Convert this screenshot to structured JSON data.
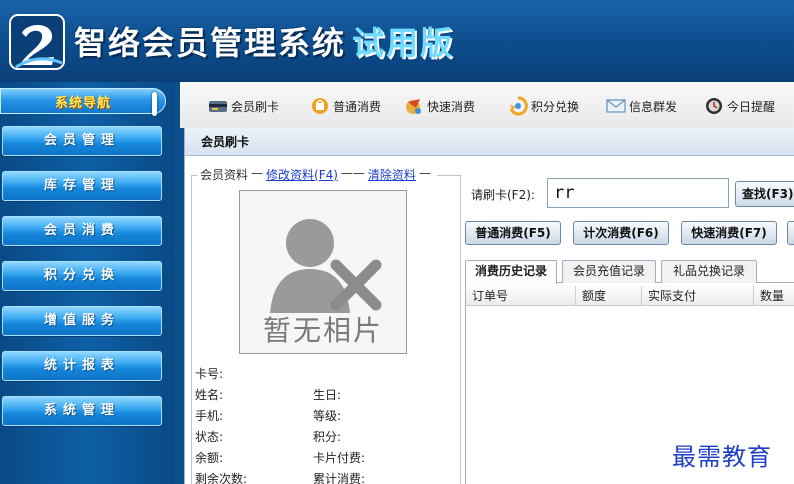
{
  "app": {
    "title": "智络会员管理系统",
    "badge": "试用版"
  },
  "sidebar": {
    "header": "系统导航",
    "items": [
      {
        "label": "会员管理"
      },
      {
        "label": "库存管理"
      },
      {
        "label": "会员消费"
      },
      {
        "label": "积分兑换"
      },
      {
        "label": "增值服务"
      },
      {
        "label": "统计报表"
      },
      {
        "label": "系统管理"
      }
    ]
  },
  "toolbar": {
    "items": [
      {
        "label": "会员刷卡",
        "icon": "card-reader-icon"
      },
      {
        "label": "普通消费",
        "icon": "shopping-icon"
      },
      {
        "label": "快速消费",
        "icon": "fast-consume-icon"
      },
      {
        "label": "积分兑换",
        "icon": "points-exchange-icon"
      },
      {
        "label": "信息群发",
        "icon": "mail-icon"
      },
      {
        "label": "今日提醒",
        "icon": "reminder-icon"
      }
    ]
  },
  "panel": {
    "title": "会员刷卡",
    "member": {
      "legend": "会员资料",
      "edit_link": "修改资料(F4)",
      "clear_link": "清除资料",
      "photo_text": "暂无相片",
      "fields": {
        "card_no": "卡号:",
        "name": "姓名:",
        "birthday": "生日:",
        "phone": "手机:",
        "level": "等级:",
        "status": "状态:",
        "points": "积分:",
        "balance": "余额:",
        "card_fee": "卡片付费:",
        "remaining_times": "剩余次数:",
        "total_consume": "累计消费:"
      }
    },
    "card": {
      "label": "请刷卡(F2):",
      "value": "rr",
      "search_label": "查找(F3)"
    },
    "actions": [
      {
        "label": "普通消费(F5)"
      },
      {
        "label": "计次消费(F6)"
      },
      {
        "label": "快速消费(F7)"
      }
    ],
    "tabs": [
      {
        "label": "消费历史记录",
        "active": true
      },
      {
        "label": "会员充值记录",
        "active": false
      },
      {
        "label": "礼品兑换记录",
        "active": false
      }
    ],
    "grid": {
      "columns": [
        "订单号",
        "额度",
        "实际支付",
        "数量"
      ]
    }
  },
  "watermark": "最需教育",
  "colors": {
    "header": "#0c4f8c",
    "nav": "#1487db",
    "link": "#1c3fd1"
  }
}
